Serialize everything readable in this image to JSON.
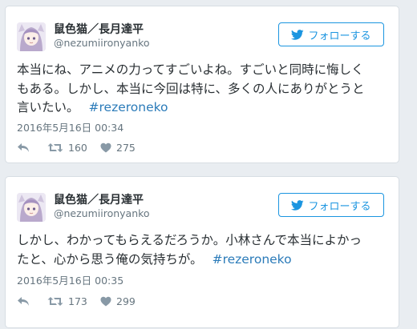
{
  "tweets": [
    {
      "display_name": "鼠色猫／長月達平",
      "handle": "@nezumiironyanko",
      "follow_label": "フォローする",
      "text": "本当にね、アニメの力ってすごいよね。すごいと同時に悔しく\nもある。しかし、本当に今回は特に、多くの人にありがとうと\n言いたい。",
      "hashtag": "#rezeroneko",
      "timestamp": "2016年5月16日 00:34",
      "retweets": "160",
      "likes": "275"
    },
    {
      "display_name": "鼠色猫／長月達平",
      "handle": "@nezumiironyanko",
      "follow_label": "フォローする",
      "text": "しかし、わかってもらえるだろうか。小林さんで本当によかっ\nたと、心から思う俺の気持ちが。",
      "hashtag": "#rezeroneko",
      "timestamp": "2016年5月16日 00:35",
      "retweets": "173",
      "likes": "299"
    }
  ],
  "icons": {
    "follow": "twitter-bird-icon",
    "reply": "reply-icon",
    "retweet": "retweet-icon",
    "like": "heart-icon"
  },
  "colors": {
    "accent": "#1b95e0",
    "hashtag": "#2b7bb9",
    "meta_text": "#66757f"
  }
}
